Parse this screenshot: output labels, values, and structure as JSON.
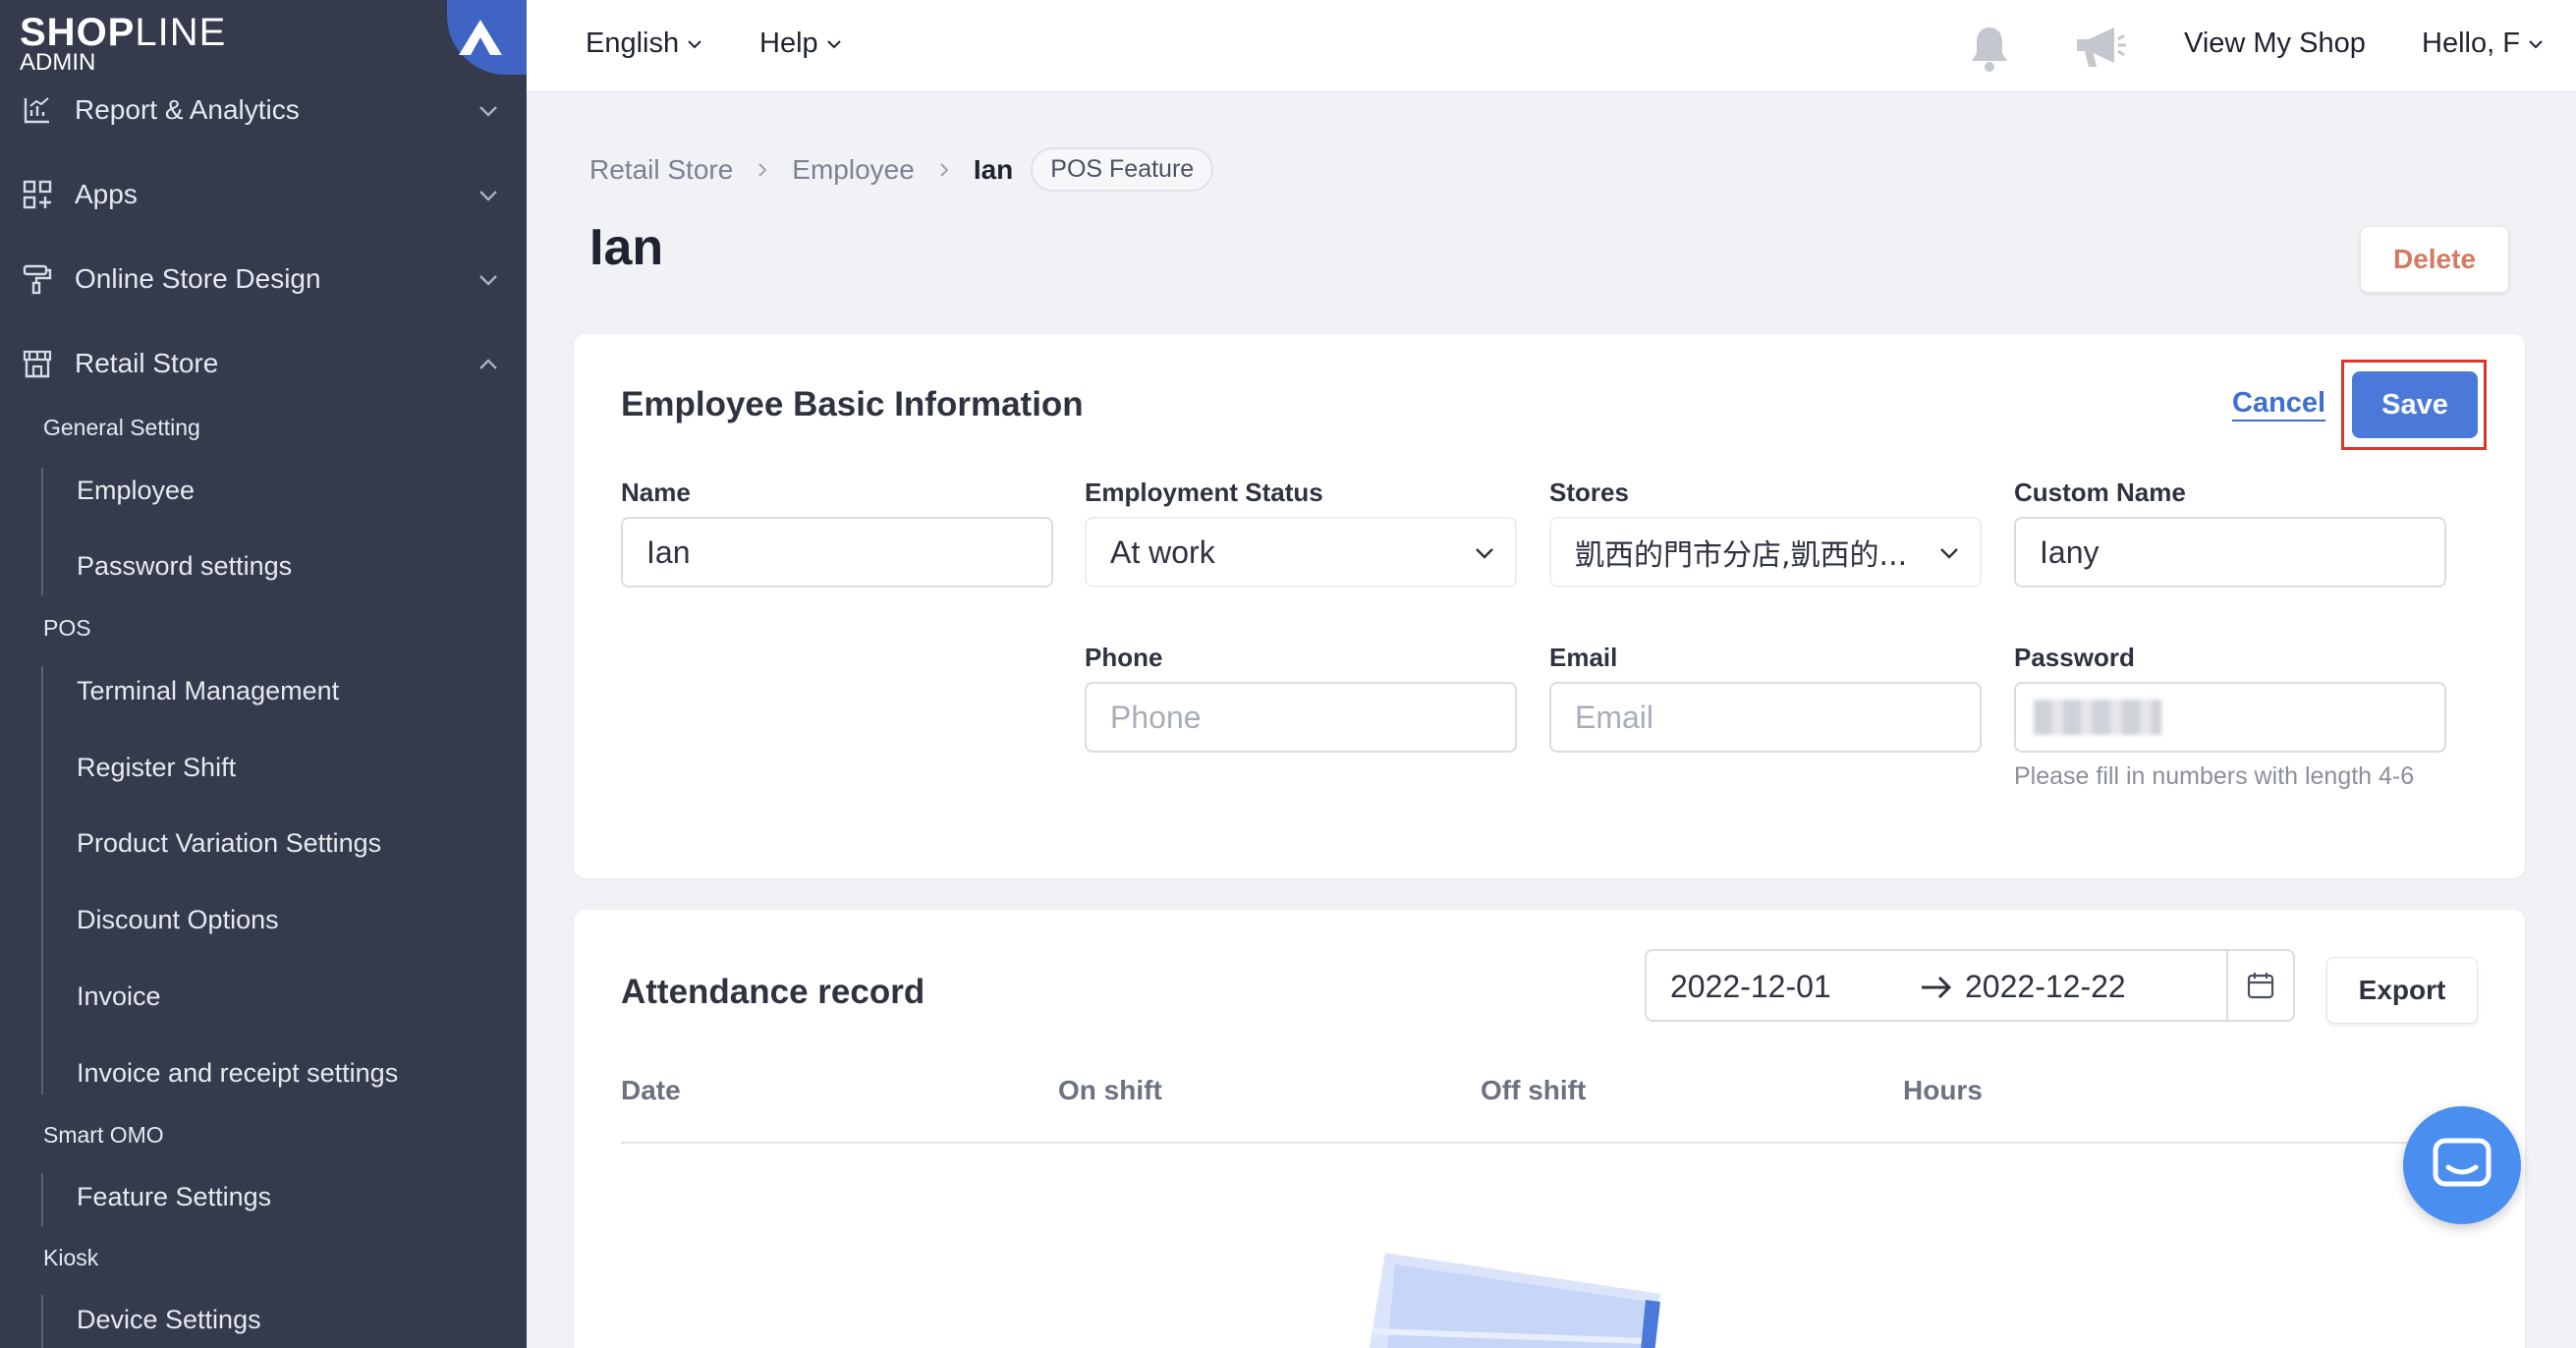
{
  "sidebar": {
    "logo": {
      "brand_bold": "SHOP",
      "brand_thin": "LINE",
      "sub": "ADMIN"
    },
    "nav": [
      {
        "label": "Report & Analytics",
        "icon": "chart-icon",
        "expanded": false
      },
      {
        "label": "Apps",
        "icon": "apps-icon",
        "expanded": false
      },
      {
        "label": "Online Store Design",
        "icon": "paint-roller-icon",
        "expanded": false
      },
      {
        "label": "Retail Store",
        "icon": "store-icon",
        "expanded": true
      }
    ],
    "sections": {
      "general": {
        "title": "General Setting",
        "items": [
          "Employee",
          "Password settings"
        ]
      },
      "pos": {
        "title": "POS",
        "items": [
          "Terminal Management",
          "Register Shift",
          "Product Variation Settings",
          "Discount Options",
          "Invoice",
          "Invoice and receipt settings"
        ]
      },
      "omo": {
        "title": "Smart OMO",
        "items": [
          "Feature Settings"
        ]
      },
      "kiosk": {
        "title": "Kiosk",
        "items": [
          "Device Settings"
        ]
      }
    }
  },
  "topbar": {
    "language": "English",
    "help": "Help",
    "view_shop": "View My Shop",
    "greeting": "Hello, F"
  },
  "breadcrumb": {
    "items": [
      "Retail Store",
      "Employee"
    ],
    "current": "Ian",
    "badge": "POS Feature"
  },
  "page": {
    "title": "Ian",
    "delete_label": "Delete"
  },
  "basic_info": {
    "title": "Employee Basic Information",
    "cancel_label": "Cancel",
    "save_label": "Save",
    "fields": {
      "name": {
        "label": "Name",
        "value": "Ian"
      },
      "status": {
        "label": "Employment Status",
        "value": "At work"
      },
      "stores": {
        "label": "Stores",
        "value": "凱西的門市分店,凱西的..."
      },
      "custom_name": {
        "label": "Custom Name",
        "value": "Iany"
      },
      "phone": {
        "label": "Phone",
        "placeholder": "Phone"
      },
      "email": {
        "label": "Email",
        "placeholder": "Email"
      },
      "password": {
        "label": "Password",
        "hint": "Please fill in numbers with length 4-6"
      }
    }
  },
  "attendance": {
    "title": "Attendance record",
    "start_date": "2022-12-01",
    "end_date": "2022-12-22",
    "export_label": "Export",
    "columns": [
      "Date",
      "On shift",
      "Off shift",
      "Hours"
    ]
  },
  "colors": {
    "sidebar_bg": "#353b4d",
    "accent": "#4a79d9",
    "danger": "#d57a62",
    "highlight": "#d8382c"
  }
}
